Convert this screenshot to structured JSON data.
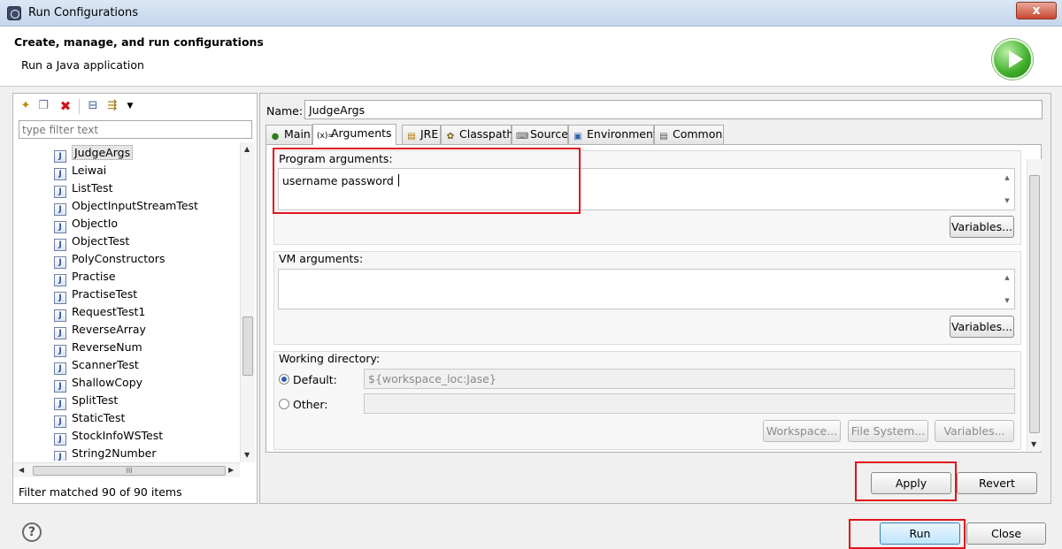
{
  "window": {
    "title": "Run Configurations",
    "close_glyph": "x"
  },
  "header": {
    "title": "Create, manage, and run configurations",
    "subtitle": "Run a Java application",
    "badge_icon": "run-play-icon"
  },
  "left": {
    "toolbar_icons": [
      "new-config-icon",
      "duplicate-icon",
      "delete-icon",
      "collapse-all-icon",
      "filter-icon",
      "dropdown-arrow-icon"
    ],
    "filter_placeholder": "type filter text",
    "items": [
      {
        "label": "JudgeArgs",
        "selected": true
      },
      {
        "label": "Leiwai"
      },
      {
        "label": "ListTest"
      },
      {
        "label": "ObjectInputStreamTest"
      },
      {
        "label": "ObjectIo"
      },
      {
        "label": "ObjectTest"
      },
      {
        "label": "PolyConstructors"
      },
      {
        "label": "Practise"
      },
      {
        "label": "PractiseTest"
      },
      {
        "label": "RequestTest1"
      },
      {
        "label": "ReverseArray"
      },
      {
        "label": "ReverseNum"
      },
      {
        "label": "ScannerTest"
      },
      {
        "label": "ShallowCopy"
      },
      {
        "label": "SplitTest"
      },
      {
        "label": "StaticTest"
      },
      {
        "label": "StockInfoWSTest"
      },
      {
        "label": "String2Number"
      }
    ],
    "hscroll_glyph": "III",
    "status": "Filter matched 90 of 90 items"
  },
  "right": {
    "name_label": "Name:",
    "name_value": "JudgeArgs",
    "tabs": [
      {
        "label": "Main"
      },
      {
        "label": "Arguments",
        "active": true
      },
      {
        "label": "JRE"
      },
      {
        "label": "Classpath"
      },
      {
        "label": "Source"
      },
      {
        "label": "Environment"
      },
      {
        "label": "Common"
      }
    ],
    "program_args": {
      "label": "Program arguments:",
      "value": "username  password",
      "variables_label": "Variables..."
    },
    "vm_args": {
      "label": "VM arguments:",
      "value": "",
      "variables_label": "Variables..."
    },
    "working_dir": {
      "label": "Working directory:",
      "default_label": "Default:",
      "default_value": "${workspace_loc:Jase}",
      "other_label": "Other:",
      "other_value": "",
      "selected": "Default",
      "buttons": [
        "Workspace...",
        "File System...",
        "Variables..."
      ]
    },
    "apply_label": "Apply",
    "revert_label": "Revert"
  },
  "footer": {
    "help_glyph": "?",
    "run_label": "Run",
    "close_label": "Close"
  },
  "colors": {
    "highlight_box": "#e0141c",
    "run_badge": "#3fae2a"
  }
}
